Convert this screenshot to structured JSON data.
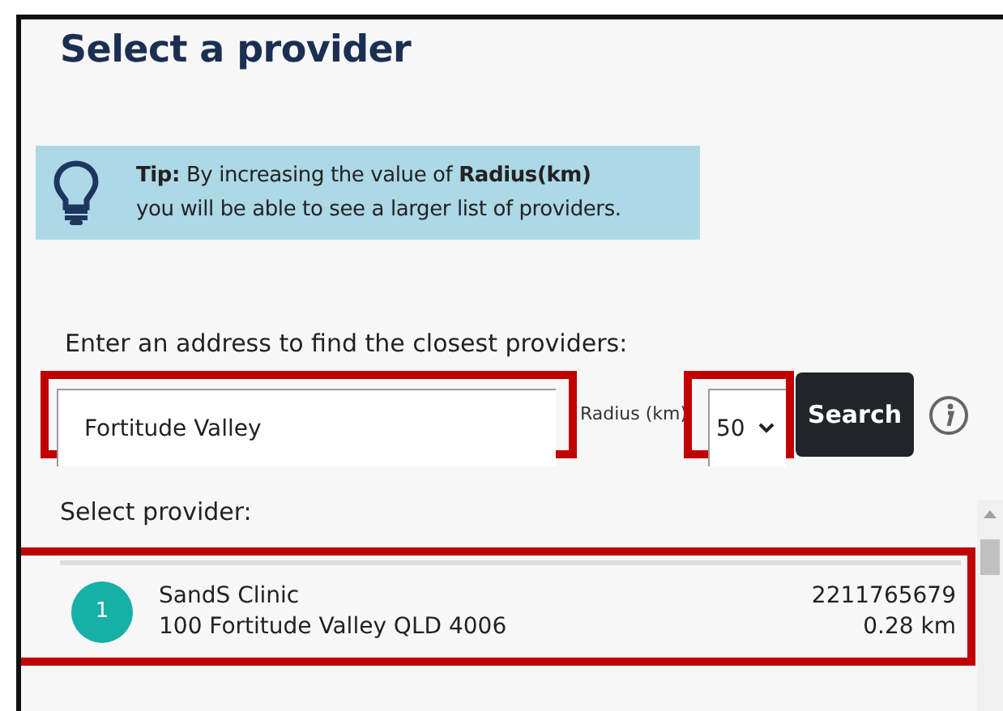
{
  "title": "Select a provider",
  "tip": {
    "text": "**Tip:** By increasing the value of **Radius(km)**\nyou will be able to see a larger list of providers."
  },
  "search": {
    "label": "Enter an address to find the closest providers:",
    "address": {
      "value": "Fortitude Valley",
      "highlighted": true
    },
    "radius": {
      "label": "Radius (km)",
      "value": "50",
      "highlighted": true
    },
    "button": "Search"
  },
  "providers_label": "Select provider:",
  "providers": [
    {
      "number": "1",
      "name": "SandS Clinic",
      "address": "100 Fortitude Valley QLD 4006",
      "id": "2211765679",
      "distance": "0.28 km",
      "highlighted": true
    }
  ]
}
